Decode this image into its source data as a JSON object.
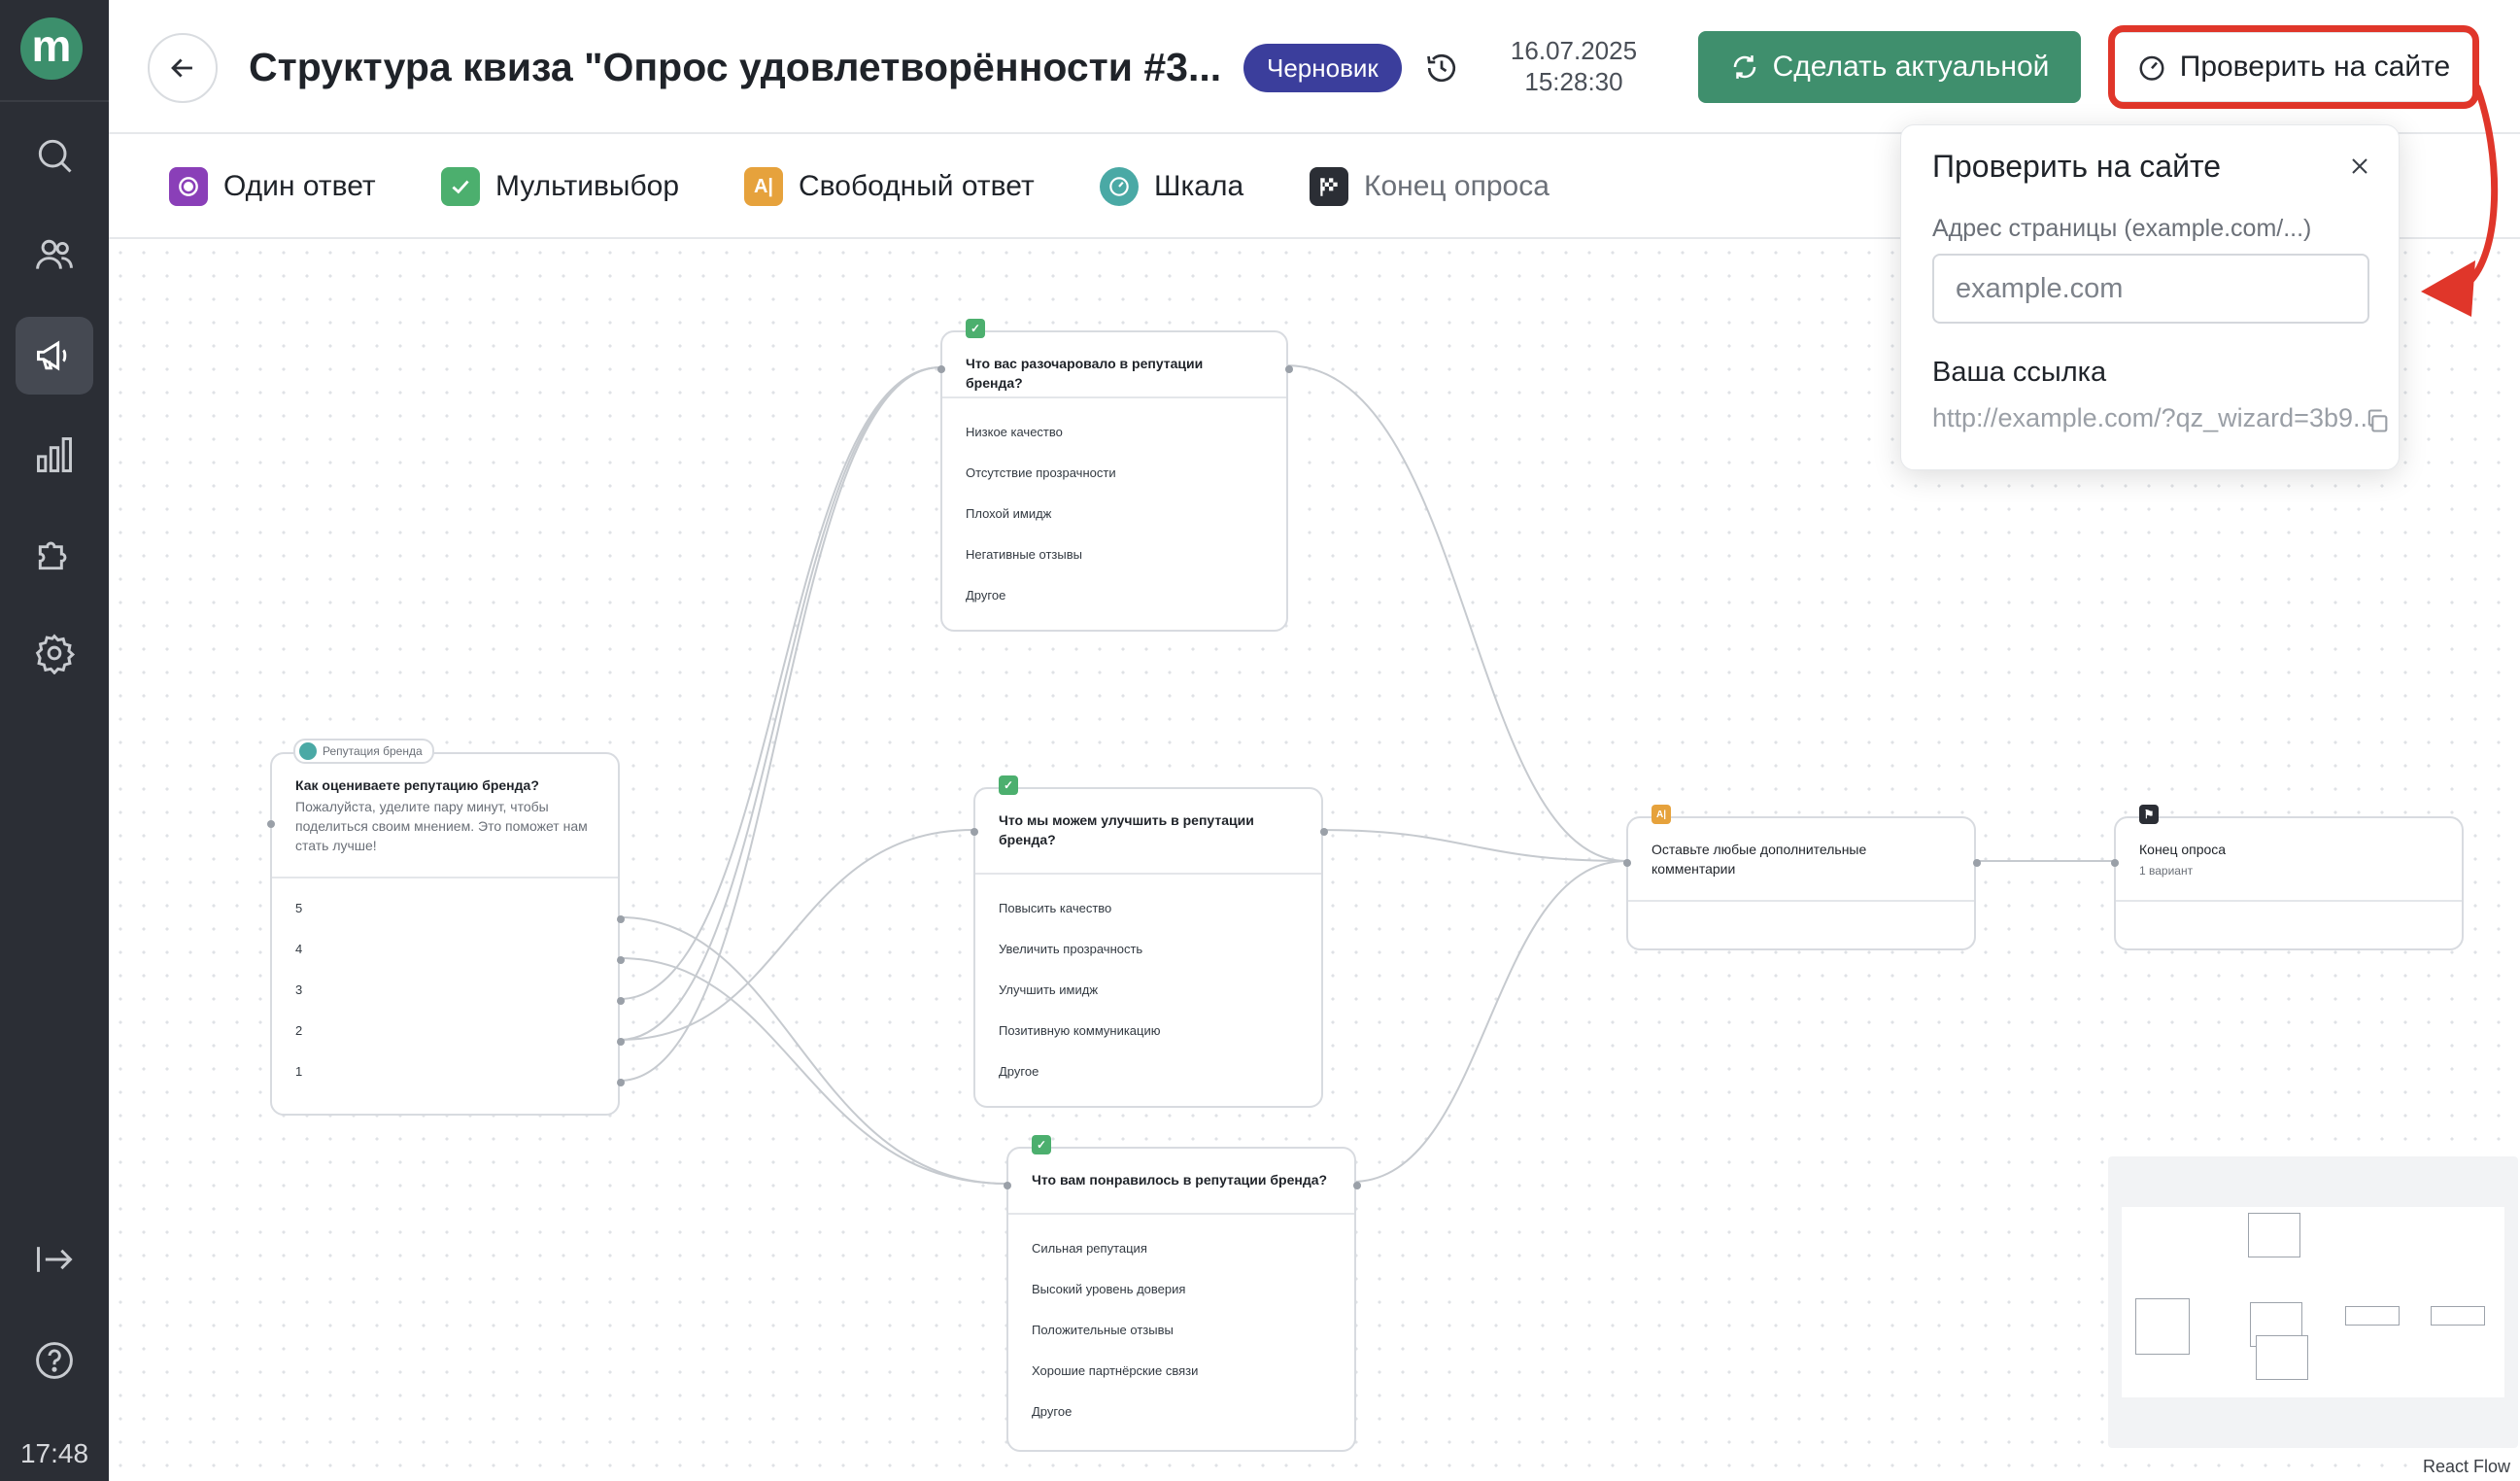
{
  "sidebar": {
    "logo": "m",
    "time": "17:48",
    "items": [
      {
        "name": "search"
      },
      {
        "name": "users"
      },
      {
        "name": "campaigns"
      },
      {
        "name": "analytics"
      },
      {
        "name": "integrations"
      },
      {
        "name": "settings"
      }
    ]
  },
  "header": {
    "title": "Структура квиза \"Опрос удовлетворённости #3...",
    "status": "Черновик",
    "date": "16.07.2025",
    "time": "15:28:30",
    "make_actual": "Сделать актуальной",
    "check_on_site": "Проверить на сайте"
  },
  "toolbar": {
    "single": "Один ответ",
    "multi": "Мультивыбор",
    "free": "Свободный ответ",
    "scale": "Шкала",
    "end": "Конец опроса"
  },
  "nodes": {
    "scale": {
      "tag": "Репутация бренда",
      "question": "Как оцениваете репутацию бренда?",
      "description": "Пожалуйста, уделите пару минут, чтобы поделиться своим мнением. Это поможет нам стать лучше!",
      "options": [
        "5",
        "4",
        "3",
        "2",
        "1"
      ]
    },
    "disappointed": {
      "question": "Что вас разочаровало в репутации бренда?",
      "options": [
        "Низкое качество",
        "Отсутствие прозрачности",
        "Плохой имидж",
        "Негативные отзывы",
        "Другое"
      ]
    },
    "improve": {
      "question": "Что мы можем улучшить в репутации бренда?",
      "options": [
        "Повысить качество",
        "Увеличить прозрачность",
        "Улучшить имидж",
        "Позитивную коммуникацию",
        "Другое"
      ]
    },
    "liked": {
      "question": "Что вам понравилось в репутации бренда?",
      "options": [
        "Сильная репутация",
        "Высокий уровень доверия",
        "Положительные отзывы",
        "Хорошие партнёрские связи",
        "Другое"
      ]
    },
    "comments": {
      "question": "Оставьте любые дополнительные комментарии"
    },
    "end": {
      "question": "Конец опроса",
      "sub": "1 вариант"
    }
  },
  "popover": {
    "title": "Проверить на сайте",
    "label": "Адрес страницы (example.com/...)",
    "placeholder": "example.com",
    "link_label": "Ваша ссылка",
    "link": "http://example.com/?qz_wizard=3b9..."
  },
  "attribution": "React Flow",
  "colors": {
    "primary": "#3f8f6d",
    "badge": "#3b3e9c",
    "single": "#8a3fb8",
    "multi": "#4caf6e",
    "free": "#e6a23c",
    "scale": "#4aa9a5",
    "end": "#2b2e35",
    "annotation": "#e0362a"
  }
}
